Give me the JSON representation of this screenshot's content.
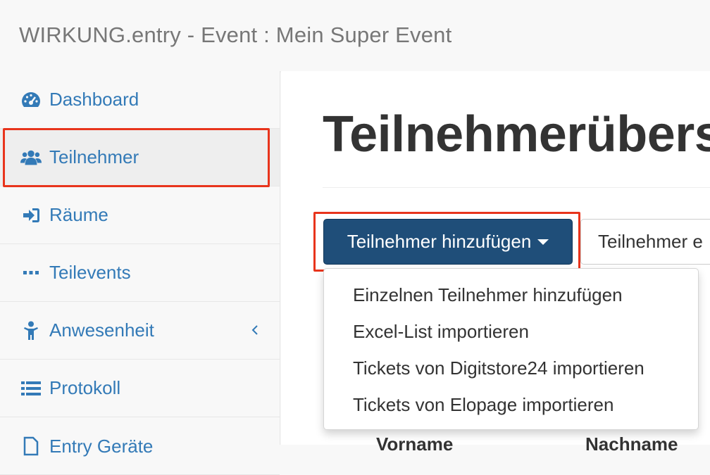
{
  "app": {
    "title": "WIRKUNG.entry - Event : Mein Super Event"
  },
  "colors": {
    "link": "#337ab7",
    "primary_button": "#1f4e79",
    "highlight": "#e8341c"
  },
  "sidebar": {
    "items": [
      {
        "label": "Dashboard",
        "icon": "tachometer-icon"
      },
      {
        "label": "Teilnehmer",
        "icon": "users-icon",
        "active": true
      },
      {
        "label": "Räume",
        "icon": "sign-in-icon"
      },
      {
        "label": "Teilevents",
        "icon": "ellipsis-icon"
      },
      {
        "label": "Anwesenheit",
        "icon": "child-icon",
        "has_submenu": true
      },
      {
        "label": "Protokoll",
        "icon": "list-icon"
      },
      {
        "label": "Entry Geräte",
        "icon": "file-icon"
      }
    ]
  },
  "main": {
    "page_title": "Teilnehmerübers",
    "add_button_label": "Teilnehmer hinzufügen",
    "export_button_label": "Teilnehmer e",
    "dropdown": [
      "Einzelnen Teilnehmer hinzufügen",
      "Excel-List importieren",
      "Tickets von Digitstore24 importieren",
      "Tickets von Elopage importieren"
    ],
    "table_headers": [
      "Vorname",
      "Nachname"
    ]
  }
}
